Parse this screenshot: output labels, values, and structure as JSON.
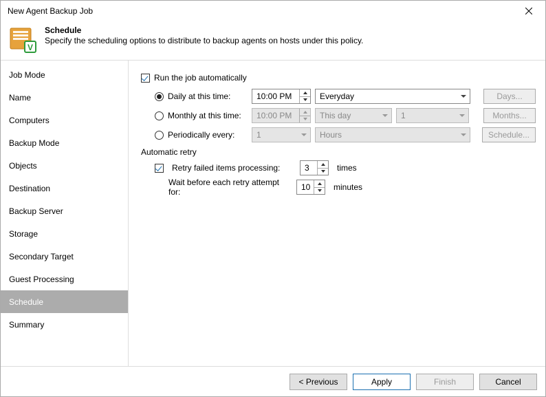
{
  "window": {
    "title": "New Agent Backup Job"
  },
  "header": {
    "title": "Schedule",
    "description": "Specify the scheduling options to distribute to backup agents on hosts under this policy."
  },
  "sidebar": {
    "items": [
      {
        "label": "Job Mode"
      },
      {
        "label": "Name"
      },
      {
        "label": "Computers"
      },
      {
        "label": "Backup Mode"
      },
      {
        "label": "Objects"
      },
      {
        "label": "Destination"
      },
      {
        "label": "Backup Server"
      },
      {
        "label": "Storage"
      },
      {
        "label": "Secondary Target"
      },
      {
        "label": "Guest Processing"
      },
      {
        "label": "Schedule"
      },
      {
        "label": "Summary"
      }
    ],
    "active_index": 10
  },
  "schedule": {
    "run_automatically_label": "Run the job automatically",
    "daily": {
      "label": "Daily at this time:",
      "time": "10:00 PM",
      "day_select": "Everyday",
      "button": "Days..."
    },
    "monthly": {
      "label": "Monthly at this time:",
      "time": "10:00 PM",
      "which": "This day",
      "num": "1",
      "button": "Months..."
    },
    "periodic": {
      "label": "Periodically every:",
      "value": "1",
      "unit": "Hours",
      "button": "Schedule..."
    }
  },
  "retry": {
    "section": "Automatic retry",
    "retry_failed_label": "Retry failed items processing:",
    "retry_count": "3",
    "retry_times_suffix": "times",
    "wait_label": "Wait before each retry attempt for:",
    "wait_value": "10",
    "wait_suffix": "minutes"
  },
  "footer": {
    "previous": "< Previous",
    "apply": "Apply",
    "finish": "Finish",
    "cancel": "Cancel"
  }
}
